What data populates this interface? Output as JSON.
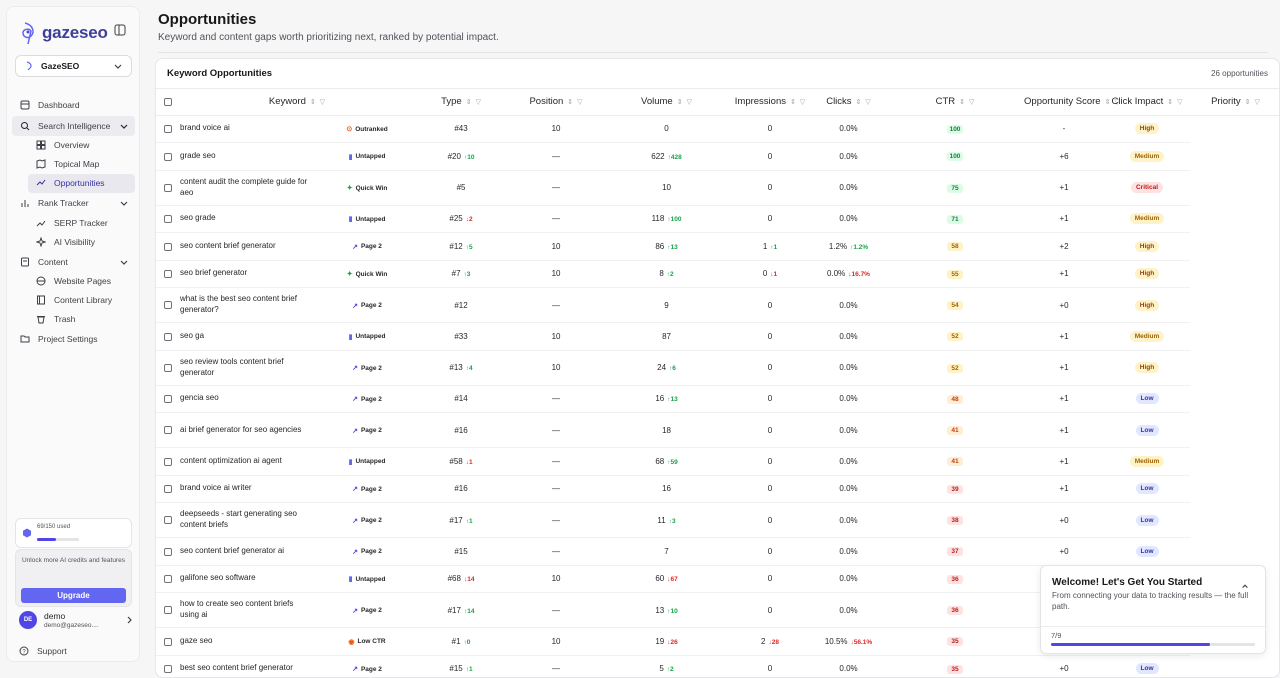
{
  "brand": {
    "name": "gazeseo"
  },
  "project": {
    "name": "GazeSEO"
  },
  "nav": {
    "dashboard": "Dashboard",
    "search_intel": "Search Intelligence",
    "overview": "Overview",
    "topical_map": "Topical Map",
    "opportunities": "Opportunities",
    "rank_tracker": "Rank Tracker",
    "serp_tracker": "SERP Tracker",
    "ai_visibility": "AI Visibility",
    "content": "Content",
    "website_pages": "Website Pages",
    "content_library": "Content Library",
    "trash": "Trash",
    "project_settings": "Project Settings"
  },
  "credits": {
    "text": "69/150 used",
    "fraction": 0.46
  },
  "upgrade": {
    "text": "Unlock more AI credits and features",
    "button": "Upgrade"
  },
  "user": {
    "initials": "DE",
    "name": "demo",
    "email": "demo@gazeseo...."
  },
  "support": "Support",
  "page": {
    "title": "Opportunities",
    "subtitle": "Keyword and content gaps worth prioritizing next, ranked by potential impact."
  },
  "card": {
    "title": "Keyword Opportunities",
    "count": "26 opportunities"
  },
  "columns": [
    "Keyword",
    "Type",
    "Position",
    "Volume",
    "Impressions",
    "Clicks",
    "CTR",
    "Opportunity Score",
    "Click Impact",
    "Priority"
  ],
  "rows": [
    {
      "kw": "brand voice ai",
      "type": "Outranked",
      "pos": "#43",
      "pd": "",
      "vol": "10",
      "imp": "0",
      "id": "",
      "clk": "0",
      "cd": "",
      "ctr": "0.0%",
      "td": "",
      "score": "100",
      "ci": "-",
      "pri": "High"
    },
    {
      "kw": "grade seo",
      "type": "Untapped",
      "pos": "#20",
      "pd": "↑10",
      "vol": "—",
      "imp": "622",
      "id": "↑428",
      "clk": "0",
      "cd": "",
      "ctr": "0.0%",
      "td": "",
      "score": "100",
      "ci": "+6",
      "pri": "Medium"
    },
    {
      "kw": "content audit the complete guide for aeo",
      "type": "Quick Win",
      "pos": "#5",
      "pd": "",
      "vol": "—",
      "imp": "10",
      "id": "",
      "clk": "0",
      "cd": "",
      "ctr": "0.0%",
      "td": "",
      "score": "75",
      "ci": "+1",
      "pri": "Critical"
    },
    {
      "kw": "seo grade",
      "type": "Untapped",
      "pos": "#25",
      "pd": "↓2",
      "vol": "—",
      "imp": "118",
      "id": "↑100",
      "clk": "0",
      "cd": "",
      "ctr": "0.0%",
      "td": "",
      "score": "71",
      "ci": "+1",
      "pri": "Medium"
    },
    {
      "kw": "seo content brief generator",
      "type": "Page 2",
      "pos": "#12",
      "pd": "↑5",
      "vol": "10",
      "imp": "86",
      "id": "↑13",
      "clk": "1",
      "cd": "↑1",
      "ctr": "1.2%",
      "td": "↑1.2%",
      "score": "58",
      "ci": "+2",
      "pri": "High"
    },
    {
      "kw": "seo brief generator",
      "type": "Quick Win",
      "pos": "#7",
      "pd": "↑3",
      "vol": "10",
      "imp": "8",
      "id": "↑2",
      "clk": "0",
      "cd": "↓1",
      "ctr": "0.0%",
      "td": "↓16.7%",
      "score": "55",
      "ci": "+1",
      "pri": "High"
    },
    {
      "kw": "what is the best seo content brief generator?",
      "type": "Page 2",
      "pos": "#12",
      "pd": "",
      "vol": "—",
      "imp": "9",
      "id": "",
      "clk": "0",
      "cd": "",
      "ctr": "0.0%",
      "td": "",
      "score": "54",
      "ci": "+0",
      "pri": "High"
    },
    {
      "kw": "seo ga",
      "type": "Untapped",
      "pos": "#33",
      "pd": "",
      "vol": "10",
      "imp": "87",
      "id": "",
      "clk": "0",
      "cd": "",
      "ctr": "0.0%",
      "td": "",
      "score": "52",
      "ci": "+1",
      "pri": "Medium"
    },
    {
      "kw": "seo review tools content brief generator",
      "type": "Page 2",
      "pos": "#13",
      "pd": "↑4",
      "vol": "10",
      "imp": "24",
      "id": "↑6",
      "clk": "0",
      "cd": "",
      "ctr": "0.0%",
      "td": "",
      "score": "52",
      "ci": "+1",
      "pri": "High"
    },
    {
      "kw": "gencia seo",
      "type": "Page 2",
      "pos": "#14",
      "pd": "",
      "vol": "—",
      "imp": "16",
      "id": "↑13",
      "clk": "0",
      "cd": "",
      "ctr": "0.0%",
      "td": "",
      "score": "48",
      "ci": "+1",
      "pri": "Low"
    },
    {
      "kw": "ai brief generator for seo agencies",
      "type": "Page 2",
      "pos": "#16",
      "pd": "",
      "vol": "—",
      "imp": "18",
      "id": "",
      "clk": "0",
      "cd": "",
      "ctr": "0.0%",
      "td": "",
      "score": "41",
      "ci": "+1",
      "pri": "Low"
    },
    {
      "kw": "content optimization ai agent",
      "type": "Untapped",
      "pos": "#58",
      "pd": "↓1",
      "vol": "—",
      "imp": "68",
      "id": "↑59",
      "clk": "0",
      "cd": "",
      "ctr": "0.0%",
      "td": "",
      "score": "41",
      "ci": "+1",
      "pri": "Medium"
    },
    {
      "kw": "brand voice ai writer",
      "type": "Page 2",
      "pos": "#16",
      "pd": "",
      "vol": "—",
      "imp": "16",
      "id": "",
      "clk": "0",
      "cd": "",
      "ctr": "0.0%",
      "td": "",
      "score": "39",
      "ci": "+1",
      "pri": "Low"
    },
    {
      "kw": "deepseeds - start generating seo content briefs",
      "type": "Page 2",
      "pos": "#17",
      "pd": "↑1",
      "vol": "—",
      "imp": "11",
      "id": "↑3",
      "clk": "0",
      "cd": "",
      "ctr": "0.0%",
      "td": "",
      "score": "38",
      "ci": "+0",
      "pri": "Low"
    },
    {
      "kw": "seo content brief generator ai",
      "type": "Page 2",
      "pos": "#15",
      "pd": "",
      "vol": "—",
      "imp": "7",
      "id": "",
      "clk": "0",
      "cd": "",
      "ctr": "0.0%",
      "td": "",
      "score": "37",
      "ci": "+0",
      "pri": "Low"
    },
    {
      "kw": "galifone seo software",
      "type": "Untapped",
      "pos": "#68",
      "pd": "↓14",
      "vol": "10",
      "imp": "60",
      "id": "↓67",
      "clk": "0",
      "cd": "",
      "ctr": "0.0%",
      "td": "",
      "score": "36",
      "ci": "",
      "pri": ""
    },
    {
      "kw": "how to create seo content briefs using ai",
      "type": "Page 2",
      "pos": "#17",
      "pd": "↑14",
      "vol": "—",
      "imp": "13",
      "id": "↑10",
      "clk": "0",
      "cd": "",
      "ctr": "0.0%",
      "td": "",
      "score": "36",
      "ci": "",
      "pri": ""
    },
    {
      "kw": "gaze seo",
      "type": "Low CTR",
      "pos": "#1",
      "pd": "↑0",
      "vol": "10",
      "imp": "19",
      "id": "↓26",
      "clk": "2",
      "cd": "↓28",
      "ctr": "10.5%",
      "td": "↓56.1%",
      "score": "35",
      "ci": "",
      "pri": ""
    },
    {
      "kw": "best seo content brief generator",
      "type": "Page 2",
      "pos": "#15",
      "pd": "↑1",
      "vol": "—",
      "imp": "5",
      "id": "↑2",
      "clk": "0",
      "cd": "",
      "ctr": "0.0%",
      "td": "",
      "score": "35",
      "ci": "+0",
      "pri": "Low"
    }
  ],
  "welcome": {
    "title": "Welcome! Let's Get You Started",
    "desc": "From connecting your data to tracking results — the full path.",
    "progress": "7/9",
    "fraction": 0.78
  },
  "colors": {
    "accent": "#4f46e5",
    "brand": "#3f3f9a"
  },
  "icons": [
    "sidebar-toggle-icon",
    "dashboard-icon",
    "search-intel-icon",
    "chevron-down-icon",
    "overview-icon",
    "map-icon",
    "trend-icon",
    "rank-icon",
    "serp-icon",
    "sparkle-icon",
    "content-icon",
    "globe-icon",
    "library-icon",
    "trash-icon",
    "folder-icon",
    "support-icon",
    "sort-icon",
    "filter-icon",
    "close-icon"
  ]
}
